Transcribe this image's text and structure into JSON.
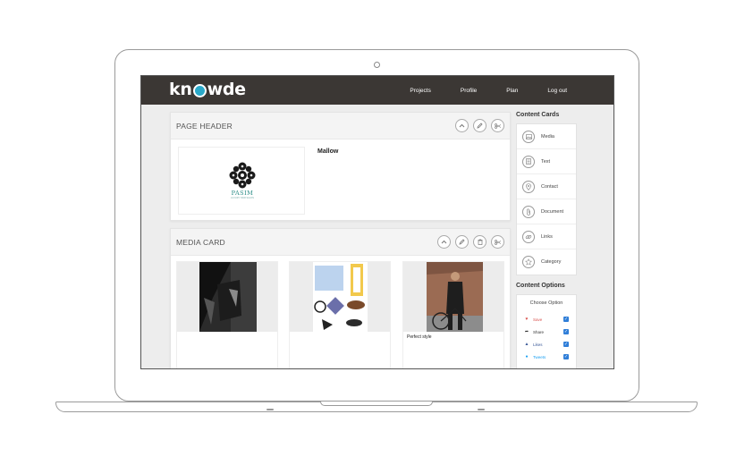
{
  "brand": {
    "logo_pre": "kn",
    "logo_post": "wde",
    "pin_color": "#2aa9c9"
  },
  "nav": {
    "items": [
      "Projects",
      "Profile",
      "Plan",
      "Log out"
    ]
  },
  "page_header": {
    "title": "PAGE HEADER",
    "heading": "Mallow",
    "image_text": "PASIM",
    "image_subtext": "LUXURY HAIR SALON",
    "actions": [
      "chevron-up-icon",
      "pencil-icon",
      "scissors-icon"
    ]
  },
  "media_card": {
    "title": "MEDIA CARD",
    "actions": [
      "chevron-up-icon",
      "pencil-icon",
      "trash-icon",
      "scissors-icon"
    ],
    "items": [
      {
        "caption": ""
      },
      {
        "caption": ""
      },
      {
        "caption": "Perfect style"
      }
    ]
  },
  "sidebar": {
    "content_cards_heading": "Content Cards",
    "cards": [
      {
        "label": "Media",
        "icon": "image-icon"
      },
      {
        "label": "Text",
        "icon": "document-text-icon"
      },
      {
        "label": "Contact",
        "icon": "location-pin-icon"
      },
      {
        "label": "Document",
        "icon": "paperclip-icon"
      },
      {
        "label": "Links",
        "icon": "link-icon"
      },
      {
        "label": "Category",
        "icon": "star-icon"
      }
    ],
    "content_options_heading": "Content Options",
    "choose_option": "Choose Option",
    "options": [
      {
        "label": "Save",
        "color": "#d9534f",
        "checked": true
      },
      {
        "label": "Share",
        "color": "#333333",
        "checked": true
      },
      {
        "label": "Likes",
        "color": "#3b5998",
        "checked": true
      },
      {
        "label": "Tweets",
        "color": "#1da1f2",
        "checked": true
      }
    ]
  }
}
